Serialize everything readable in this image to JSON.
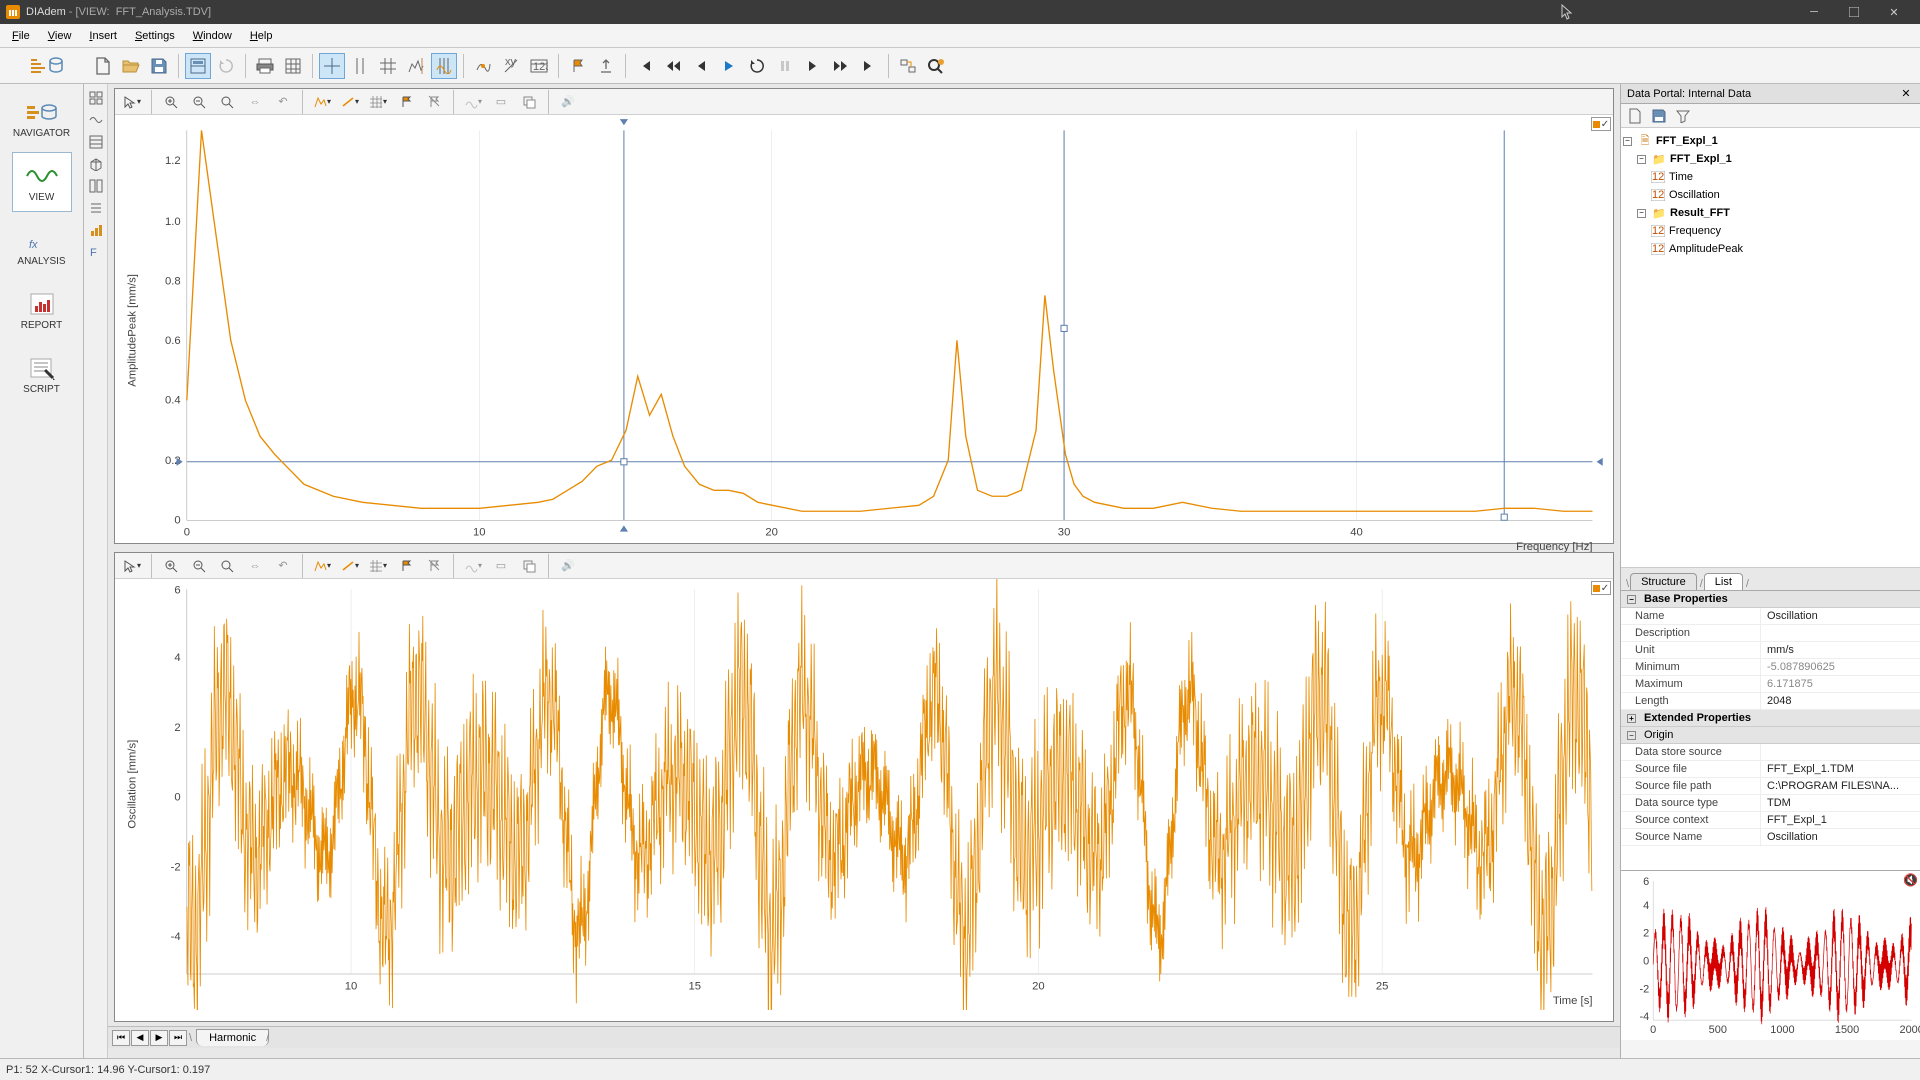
{
  "app": {
    "name": "DIAdem",
    "mode": "VIEW",
    "document": "FFT_Analysis.TDV"
  },
  "menu": [
    "File",
    "View",
    "Insert",
    "Settings",
    "Window",
    "Help"
  ],
  "nav": [
    {
      "id": "navigator",
      "label": "NAVIGATOR"
    },
    {
      "id": "view",
      "label": "VIEW"
    },
    {
      "id": "analysis",
      "label": "ANALYSIS"
    },
    {
      "id": "report",
      "label": "REPORT"
    },
    {
      "id": "script",
      "label": "SCRIPT"
    }
  ],
  "sheet_tab": "Harmonic",
  "status": "P1: 52 X-Cursor1: 14.96 Y-Cursor1: 0.197",
  "chart_data": [
    {
      "type": "line",
      "title": "",
      "xlabel": "Frequency [Hz]",
      "ylabel": "AmplitudePeak [mm/s]",
      "xlim": [
        0,
        48
      ],
      "ylim": [
        0,
        1.3
      ],
      "xticks": [
        0,
        10,
        20,
        30,
        40
      ],
      "yticks": [
        0.2,
        0.4,
        0.6,
        0.8,
        1.0,
        1.2
      ],
      "cursor_lines": {
        "x": [
          14.96,
          30.0,
          46.5
        ],
        "y": 0.197
      },
      "series": [
        {
          "name": "AmplitudePeak",
          "x": [
            0.0,
            0.5,
            1.0,
            1.5,
            2.0,
            2.5,
            3.0,
            3.5,
            4.0,
            5.0,
            6.0,
            7.0,
            8.0,
            9.0,
            10.0,
            11.0,
            12.0,
            12.5,
            13.0,
            13.5,
            14.0,
            14.5,
            15.0,
            15.4,
            15.8,
            16.2,
            16.6,
            17.0,
            17.5,
            18.0,
            18.5,
            19.0,
            19.5,
            20.0,
            21.0,
            22.0,
            23.0,
            24.0,
            25.0,
            25.5,
            26.0,
            26.3,
            26.6,
            27.0,
            27.5,
            28.0,
            28.5,
            29.0,
            29.3,
            29.6,
            30.0,
            30.3,
            30.6,
            31.0,
            31.5,
            32.0,
            33.0,
            34.0,
            35.0,
            36.0,
            37.0,
            38.0,
            39.0,
            40.0,
            41.0,
            42.0,
            43.0,
            44.0,
            45.0,
            46.0,
            47.0,
            48.0
          ],
          "values": [
            0.4,
            1.3,
            0.95,
            0.6,
            0.4,
            0.28,
            0.22,
            0.17,
            0.12,
            0.08,
            0.06,
            0.05,
            0.04,
            0.04,
            0.04,
            0.05,
            0.06,
            0.07,
            0.1,
            0.13,
            0.18,
            0.2,
            0.3,
            0.48,
            0.35,
            0.42,
            0.28,
            0.18,
            0.12,
            0.1,
            0.1,
            0.09,
            0.06,
            0.05,
            0.03,
            0.03,
            0.03,
            0.04,
            0.05,
            0.08,
            0.2,
            0.6,
            0.28,
            0.1,
            0.08,
            0.08,
            0.1,
            0.3,
            0.75,
            0.5,
            0.22,
            0.12,
            0.08,
            0.06,
            0.05,
            0.04,
            0.04,
            0.06,
            0.04,
            0.03,
            0.03,
            0.03,
            0.03,
            0.03,
            0.03,
            0.03,
            0.03,
            0.03,
            0.04,
            0.04,
            0.03,
            0.03
          ]
        }
      ]
    },
    {
      "type": "line",
      "title": "",
      "xlabel": "Time [s]",
      "ylabel": "Oscillation [mm/s]",
      "xlim": [
        0,
        32
      ],
      "ylim": [
        -5,
        6
      ],
      "xticks": [
        10,
        15,
        20,
        25
      ],
      "yticks": [
        -4,
        -2,
        0,
        2,
        4,
        6
      ],
      "series": [
        {
          "name": "Oscillation",
          "description": "noisy periodic signal ~0.95 Hz visible envelope, amplitude approx ±4.5 mm/s"
        }
      ]
    }
  ],
  "data_portal": {
    "title": "Data Portal: Internal Data",
    "tree": {
      "root": "FFT_Expl_1",
      "groups": [
        {
          "name": "FFT_Expl_1",
          "channels": [
            "Time",
            "Oscillation"
          ]
        },
        {
          "name": "Result_FFT",
          "channels": [
            "Frequency",
            "AmplitudePeak"
          ]
        }
      ]
    },
    "tabs": [
      "Structure",
      "List"
    ],
    "active_tab": "List"
  },
  "properties": {
    "base_section": "Base Properties",
    "ext_section": "Extended Properties",
    "origin_section": "Origin",
    "rows": [
      {
        "k": "Name",
        "v": "Oscillation"
      },
      {
        "k": "Description",
        "v": ""
      },
      {
        "k": "Unit",
        "v": "mm/s"
      },
      {
        "k": "Minimum",
        "v": "-5.087890625",
        "gray": true
      },
      {
        "k": "Maximum",
        "v": "6.171875",
        "gray": true
      },
      {
        "k": "Length",
        "v": "2048"
      }
    ],
    "origin_rows": [
      {
        "k": "Data store source",
        "v": ""
      },
      {
        "k": "Source file",
        "v": "FFT_Expl_1.TDM"
      },
      {
        "k": "Source file path",
        "v": "C:\\PROGRAM FILES\\NA..."
      },
      {
        "k": "Data source type",
        "v": "TDM"
      },
      {
        "k": "Source context",
        "v": "FFT_Expl_1"
      },
      {
        "k": "Source Name",
        "v": "Oscillation"
      }
    ]
  },
  "preview_chart": {
    "type": "line",
    "xlim": [
      0,
      2000
    ],
    "ylim": [
      -4,
      6
    ],
    "xticks": [
      0,
      500,
      1000,
      1500,
      2000
    ],
    "yticks": [
      -4,
      -2,
      0,
      2,
      4,
      6
    ],
    "color": "#d40000"
  }
}
